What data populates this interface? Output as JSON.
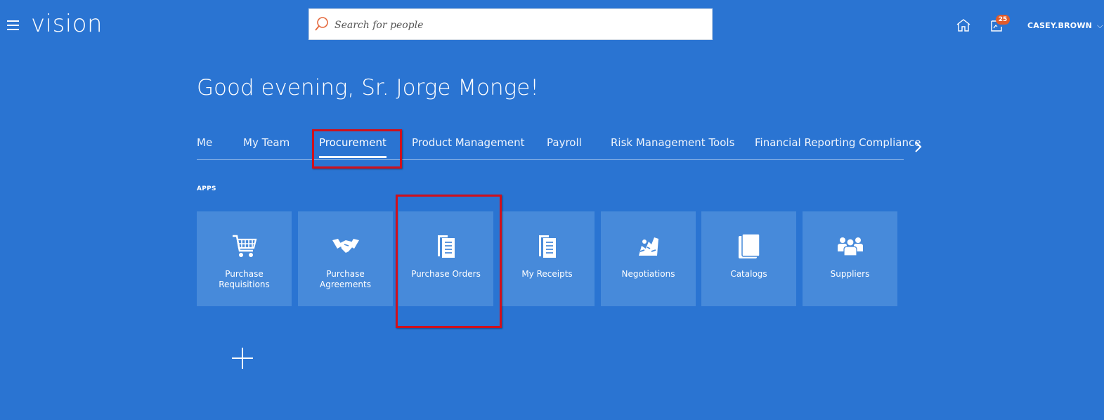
{
  "header": {
    "logo": "vision",
    "search_placeholder": "Search for people",
    "notification_count": "25",
    "user_name": "CASEY.BROWN"
  },
  "greeting": "Good evening, Sr. Jorge Monge!",
  "tabs": [
    {
      "label": "Me"
    },
    {
      "label": "My Team"
    },
    {
      "label": "Procurement",
      "active": true
    },
    {
      "label": "Product Management"
    },
    {
      "label": "Payroll"
    },
    {
      "label": "Risk Management Tools"
    },
    {
      "label": "Financial Reporting Compliance"
    }
  ],
  "apps_label": "APPS",
  "apps": [
    {
      "label": "Purchase Requisitions",
      "icon": "shopping-cart-icon"
    },
    {
      "label": "Purchase Agreements",
      "icon": "handshake-icon"
    },
    {
      "label": "Purchase Orders",
      "icon": "documents-icon"
    },
    {
      "label": "My Receipts",
      "icon": "receipts-icon"
    },
    {
      "label": "Negotiations",
      "icon": "negotiations-icon"
    },
    {
      "label": "Catalogs",
      "icon": "catalogs-icon"
    },
    {
      "label": "Suppliers",
      "icon": "suppliers-icon"
    }
  ],
  "colors": {
    "background": "#2a74d2",
    "tile": "#478ada",
    "badge": "#e25b2a",
    "highlight": "#d0101c",
    "search_icon": "#e4673b"
  }
}
